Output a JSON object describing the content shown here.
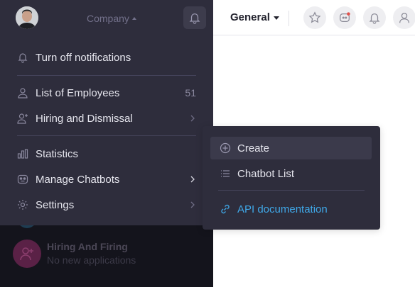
{
  "company": {
    "label": "Company"
  },
  "header": {
    "title": "General"
  },
  "menu": {
    "turn_off_notifications": "Turn off notifications",
    "employees": {
      "label": "List of Employees",
      "count": "51"
    },
    "hiring": "Hiring and Dismissal",
    "statistics": "Statistics",
    "chatbots": "Manage Chatbots",
    "settings": "Settings"
  },
  "submenu": {
    "create": "Create",
    "chatbot_list": "Chatbot List",
    "api_docs": "API documentation"
  },
  "background": {
    "chat_title": "Hiring And Firing",
    "chat_subtitle": "No new applications"
  },
  "colors": {
    "menu_bg": "#2e2d3c",
    "panel_bg": "#14141c",
    "link": "#3fa8e8",
    "text": "#e6e6ee",
    "muted": "#72708a"
  },
  "icons": {
    "header": [
      "star-icon",
      "chatbot-face-icon",
      "bell-icon",
      "user-icon"
    ],
    "menu": [
      "bell-icon",
      "user-icon",
      "add-user-icon",
      "bar-chart-icon",
      "chatbot-icon",
      "gear-icon"
    ],
    "submenu": [
      "plus-circle-icon",
      "list-icon",
      "link-icon"
    ]
  }
}
